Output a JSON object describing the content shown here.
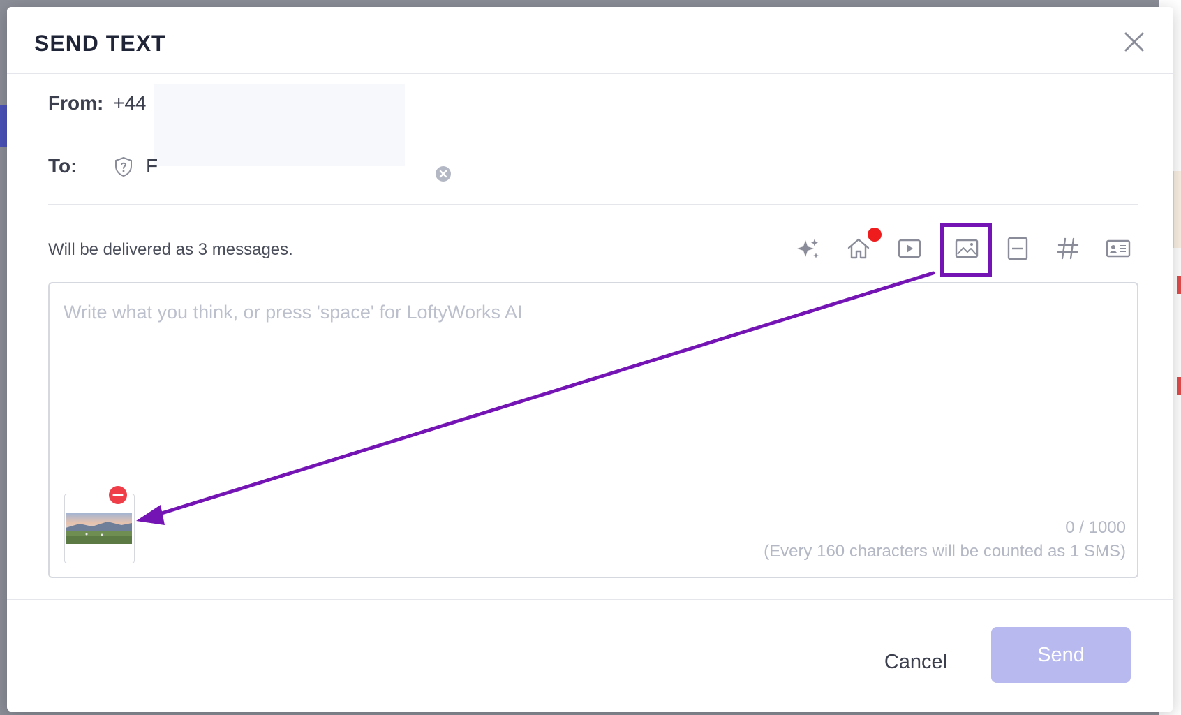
{
  "dialog": {
    "title": "SEND TEXT"
  },
  "from": {
    "label": "From:",
    "value": "+44"
  },
  "to": {
    "label": "To:",
    "recipient_initial": "F"
  },
  "delivery_note": "Will be delivered as 3 messages.",
  "toolbar": {
    "icons": [
      "ai-sparkle-icon",
      "home-listing-icon",
      "video-icon",
      "image-icon",
      "template-icon",
      "hashtag-icon",
      "contact-card-icon"
    ],
    "home_has_notification": true
  },
  "editor": {
    "placeholder": "Write what you think, or press 'space' for LoftyWorks AI",
    "counter": "0 / 1000",
    "sms_note": "(Every 160 characters will be counted as 1 SMS)"
  },
  "footer": {
    "cancel_label": "Cancel",
    "send_label": "Send"
  },
  "colors": {
    "accent_purple": "#7514b5",
    "send_disabled": "#b8b9ee",
    "notification_red": "#ee1c1c",
    "remove_red": "#ef3e48"
  }
}
